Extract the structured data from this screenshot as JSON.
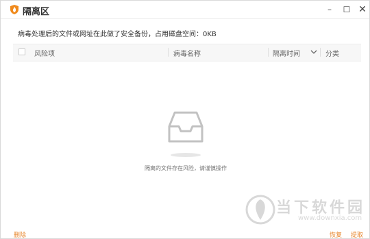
{
  "window": {
    "title": "隔离区",
    "controls": {
      "minimize": "–",
      "maximize": "☐",
      "close": "✕"
    }
  },
  "info_text": "病毒处理后的文件或网址在此做了安全备份，占用磁盘空间：0KB",
  "table": {
    "columns": [
      "风险项",
      "病毒名称",
      "隔离时间",
      "分类"
    ]
  },
  "empty_state": {
    "icon": "empty-inbox-tray-icon",
    "message": "隔离的文件存在风险，请谨慎操作"
  },
  "footer": {
    "delete": "删除",
    "restore": "恢复",
    "extract": "提取"
  },
  "watermark": {
    "name": "当下软件园",
    "url": "www.downxia.com"
  },
  "colors": {
    "accent": "#e8882f",
    "header_bg": "#f7f7f7",
    "logo_orange": "#f08a1c"
  }
}
